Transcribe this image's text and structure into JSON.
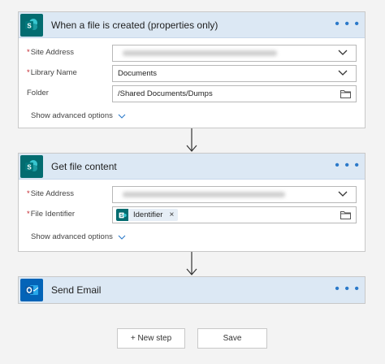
{
  "trigger": {
    "title": "When a file is created (properties only)",
    "menu": "• • •",
    "fields": {
      "site_address_label": "Site Address",
      "library_name_label": "Library Name",
      "library_name_value": "Documents",
      "folder_label": "Folder",
      "folder_value": "/Shared Documents/Dumps"
    },
    "advanced": "Show advanced options"
  },
  "get_file": {
    "title": "Get file content",
    "menu": "• • •",
    "fields": {
      "site_address_label": "Site Address",
      "file_identifier_label": "File Identifier",
      "token_label": "Identifier",
      "token_remove": "×"
    },
    "advanced": "Show advanced options"
  },
  "send_email": {
    "title": "Send Email",
    "menu": "• • •"
  },
  "required_marker": "*",
  "buttons": {
    "new_step": "+ New step",
    "save": "Save"
  },
  "colors": {
    "header_bg": "#dce8f4",
    "sharepoint": "#036c70",
    "outlook": "#0364b8",
    "accent": "#2b79c9"
  }
}
